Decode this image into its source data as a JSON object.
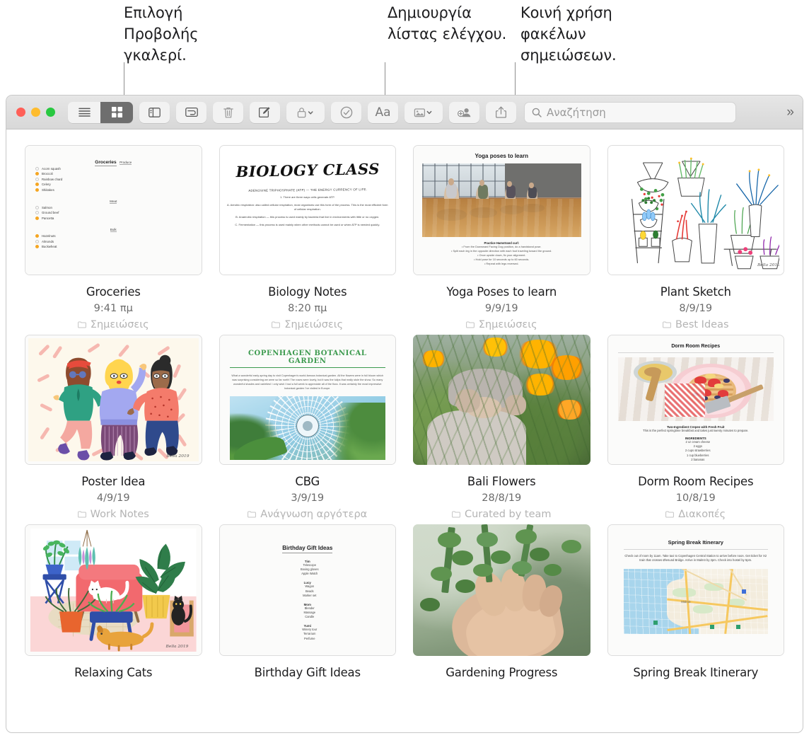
{
  "callouts": [
    {
      "text": "Επιλογή Προβολής γκαλερί."
    },
    {
      "text": "Δημιουργία λίστας ελέγχου."
    },
    {
      "text": "Κοινή χρήση φακέλων σημειώσεων."
    }
  ],
  "toolbar": {
    "window_controls": [
      "close",
      "minimize",
      "zoom"
    ],
    "buttons": [
      {
        "name": "list-view-button",
        "icon": "list-icon",
        "selected": false
      },
      {
        "name": "gallery-view-button",
        "icon": "grid-icon",
        "selected": true
      },
      {
        "name": "sidebar-toggle-button",
        "icon": "sidebar-icon",
        "selected": false
      },
      {
        "name": "new-folder-button",
        "icon": "folder-new-icon",
        "selected": false
      },
      {
        "name": "delete-button",
        "icon": "trash-icon",
        "selected": false
      },
      {
        "name": "compose-button",
        "icon": "compose-icon",
        "selected": false
      },
      {
        "name": "lock-button",
        "icon": "lock-icon",
        "selected": false
      },
      {
        "name": "checklist-button",
        "icon": "checkmark-circle-icon",
        "selected": false
      },
      {
        "name": "format-button",
        "icon": "aa-icon",
        "label": "Aa",
        "selected": false
      },
      {
        "name": "media-button",
        "icon": "photo-icon",
        "selected": false
      },
      {
        "name": "add-people-button",
        "icon": "person-add-icon",
        "selected": false
      },
      {
        "name": "share-button",
        "icon": "share-icon",
        "selected": false
      }
    ],
    "format_label": "Aa",
    "overflow_label": "»"
  },
  "search": {
    "placeholder": "Αναζήτηση",
    "value": "",
    "icon": "search-icon"
  },
  "notes": [
    {
      "title": "Groceries",
      "date": "9:41 πμ",
      "folder": "Σημειώσεις",
      "preview_type": "checklist",
      "preview": {
        "heading": "Groceries",
        "sections": [
          {
            "name": "Produce",
            "items": [
              {
                "label": "Acorn squash",
                "checked": false
              },
              {
                "label": "Broccoli",
                "checked": true
              },
              {
                "label": "Rainbow chard",
                "checked": false
              },
              {
                "label": "Celery",
                "checked": true
              },
              {
                "label": "Shiitakes",
                "checked": true
              }
            ]
          },
          {
            "name": "Meat",
            "items": [
              {
                "label": "Salmon",
                "checked": false
              },
              {
                "label": "Ground beef",
                "checked": false
              },
              {
                "label": "Pancetta",
                "checked": true
              }
            ]
          },
          {
            "name": "Bulk",
            "items": [
              {
                "label": "Hazelnuts",
                "checked": true
              },
              {
                "label": "Almonds",
                "checked": false
              },
              {
                "label": "Buckwheat",
                "checked": true
              }
            ]
          }
        ]
      }
    },
    {
      "title": "Biology Notes",
      "date": "8:20 πμ",
      "folder": "Σημειώσεις",
      "preview_type": "handwriting",
      "preview": {
        "heading": "BIOLOGY CLASS",
        "subheading": "ADENOSINE TRIPHOSPHATE (ATP) — THE ENERGY CURRENCY OF LIFE.",
        "items": [
          "1. There are three ways cells generate ATP.",
          "A. Aerobic respiration: also called cellular respiration, most organisms use this form of the process. This is the most efficient form of cellular respiration.",
          "B. Anaerobic respiration — this process is used mainly by bacteria that live in environments with little or no oxygen.",
          "C. Fermentation — this process is used mainly when other methods cannot be used or when ATP is needed quickly."
        ],
        "highlights": [
          "three ways cells",
          "Aerobic respiration",
          "Anaerobic respiration",
          "Fermentation"
        ]
      }
    },
    {
      "title": "Yoga Poses to learn",
      "date": "9/9/19",
      "folder": "Σημειώσεις",
      "preview_type": "photo-note",
      "preview": {
        "heading": "Yoga poses to learn",
        "image_alt": "four women in a studio seated with arms raised overhead",
        "caption_heading": "Practice Hamstrand curl:",
        "caption_lines": [
          "• From the Downward Facing Dog position, do a handstand pose.",
          "• Split each leg in the opposite direction with each foot traveling toward the ground.",
          "• Once upside down, fix your alignment.",
          "• Hold pose for 10 seconds up to 60 seconds.",
          "• Repeat with legs reversed."
        ]
      }
    },
    {
      "title": "Plant Sketch",
      "date": "8/9/19",
      "folder": "Best Ideas",
      "preview_type": "illustration-plants",
      "preview": {
        "image_alt": "line drawing of houseplants on shelves and a ladder",
        "signature": "Bella 2019"
      }
    },
    {
      "title": "Poster Idea",
      "date": "4/9/19",
      "folder": "Work Notes",
      "preview_type": "illustration-friends",
      "preview": {
        "image_alt": "three stylized friends standing together on a cream background with pink dashes",
        "signature": "Bella 2019"
      }
    },
    {
      "title": "CBG",
      "date": "3/9/19",
      "folder": "Ανάγνωση αργότερα",
      "preview_type": "garden-note",
      "preview": {
        "heading": "COPENHAGEN BOTANICAL GARDEN",
        "paragraph": "What a wonderful early-spring day to visit Copenhagen's world-famous botanical garden. All the flowers were in full bloom which was surprising considering we were so far north! The roses were lovely, but it was the tulips that really stole the show. So many wonderful shades and varieties! I only wish I had a full week to appreciate all of the flora. It was certainly the most impressive botanical garden I've visited in Europe.",
        "image_alt": "view up into a glass greenhouse dome surrounded by foliage"
      }
    },
    {
      "title": "Bali Flowers",
      "date": "28/8/19",
      "folder": "Curated by team",
      "preview_type": "photo-full",
      "preview": {
        "image_alt": "person peeking through tall orange marigold flowers in a garden"
      }
    },
    {
      "title": "Dorm Room Recipes",
      "date": "10/8/19",
      "folder": "Διακοπές",
      "preview_type": "recipe-note",
      "preview": {
        "heading": "Dorm Room Recipes",
        "image_alt": "waffle topped with strawberries, bananas and blueberries on a pink plate with honey dipper",
        "recipe_title": "Two-Ingredient Crepes with Fresh Fruit",
        "recipe_sub": "This is the perfect springtime breakfast and takes just twenty minutes to prepare.",
        "ingredients_heading": "INGREDIENTS",
        "ingredients": [
          "2 oz cream cheese",
          "2 eggs",
          "2 cups strawberries",
          "1 cup blueberries",
          "2 bananas"
        ]
      }
    },
    {
      "title": "Relaxing Cats",
      "date": "",
      "folder": "",
      "preview_type": "illustration-room",
      "preview": {
        "image_alt": "illustrated living room with pink sofa, white cat, black cat on a chair, dog and many plants",
        "signature": "Bella 2019"
      }
    },
    {
      "title": "Birthday Gift Ideas",
      "date": "",
      "folder": "",
      "preview_type": "gift-list",
      "preview": {
        "heading": "Birthday Gift Ideas",
        "sections": [
          {
            "name": "Tim",
            "items": [
              "Telescope",
              "Boxing gloves",
              "Apple Watch"
            ]
          },
          {
            "name": "Lucy",
            "items": [
              "Wagon",
              "Beads",
              "Marker set"
            ]
          },
          {
            "name": "Mom",
            "items": [
              "Blender",
              "Massage",
              "Candle"
            ]
          },
          {
            "name": "Yumi",
            "items": [
              "Winery tour",
              "Terrarium",
              "Perfume"
            ]
          }
        ]
      }
    },
    {
      "title": "Gardening Progress",
      "date": "",
      "folder": "",
      "preview_type": "photo-full-hand",
      "preview": {
        "image_alt": "hand holding a string-of-pearls succulent plant"
      }
    },
    {
      "title": "Spring Break Itinerary",
      "date": "",
      "folder": "",
      "preview_type": "map-note",
      "preview": {
        "heading": "Spring Break Itinerary",
        "paragraph": "Check out of room by 11am. Take taxi to Copenhagen Central Station to arrive before noon. Get ticket for X2 train that crosses Øresund Bridge. Arrive in Malmö by 2pm. Check into hostel by 5pm.",
        "image_alt": "map of Malmö with coastline and highways",
        "map_label": "Malmö"
      }
    }
  ],
  "colors": {
    "accent_orange": "#f5a623",
    "toolbar_selected": "#6e6e6e",
    "folder_grey": "#b4b4b4",
    "green_title": "#3c9a4e"
  }
}
